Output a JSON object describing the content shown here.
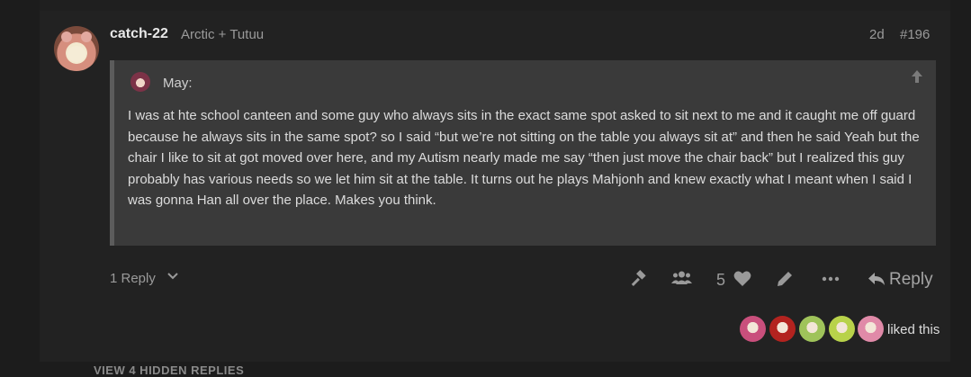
{
  "post": {
    "username": "catch-22",
    "user_title": "Arctic + Tutuu",
    "age": "2d",
    "number": "#196"
  },
  "quote": {
    "author": "May:",
    "text": "I was at hte school canteen and some guy who always sits in the exact same spot asked to sit next to me and it caught me off guard because he always sits in the same spot? so I said “but we’re not sitting on the table you always sit at” and then he said Yeah but the chair I like to sit at got moved over here, and my Autism nearly made me say “then just move the chair back” but I realized this guy probably has various needs so we let him sit at the table. It turns out he plays Mahjonh and knew exactly what I meant when I said I was gonna Han all over the place. Makes you think."
  },
  "actions": {
    "replies_label": "1 Reply",
    "like_count": "5",
    "reply_label": "Reply"
  },
  "likes": {
    "label": "liked this",
    "avatar_colors": [
      "#c94f7c",
      "#b3231f",
      "#9fc35a",
      "#b8d24a",
      "#e08aa8"
    ]
  },
  "footer": {
    "hidden_replies": "VIEW 4 HIDDEN REPLIES"
  },
  "icons": [
    "upload-arrow-icon",
    "chevron-down-icon",
    "gavel-icon",
    "users-icon",
    "heart-icon",
    "pencil-icon",
    "ellipsis-icon",
    "reply-arrow-icon"
  ]
}
